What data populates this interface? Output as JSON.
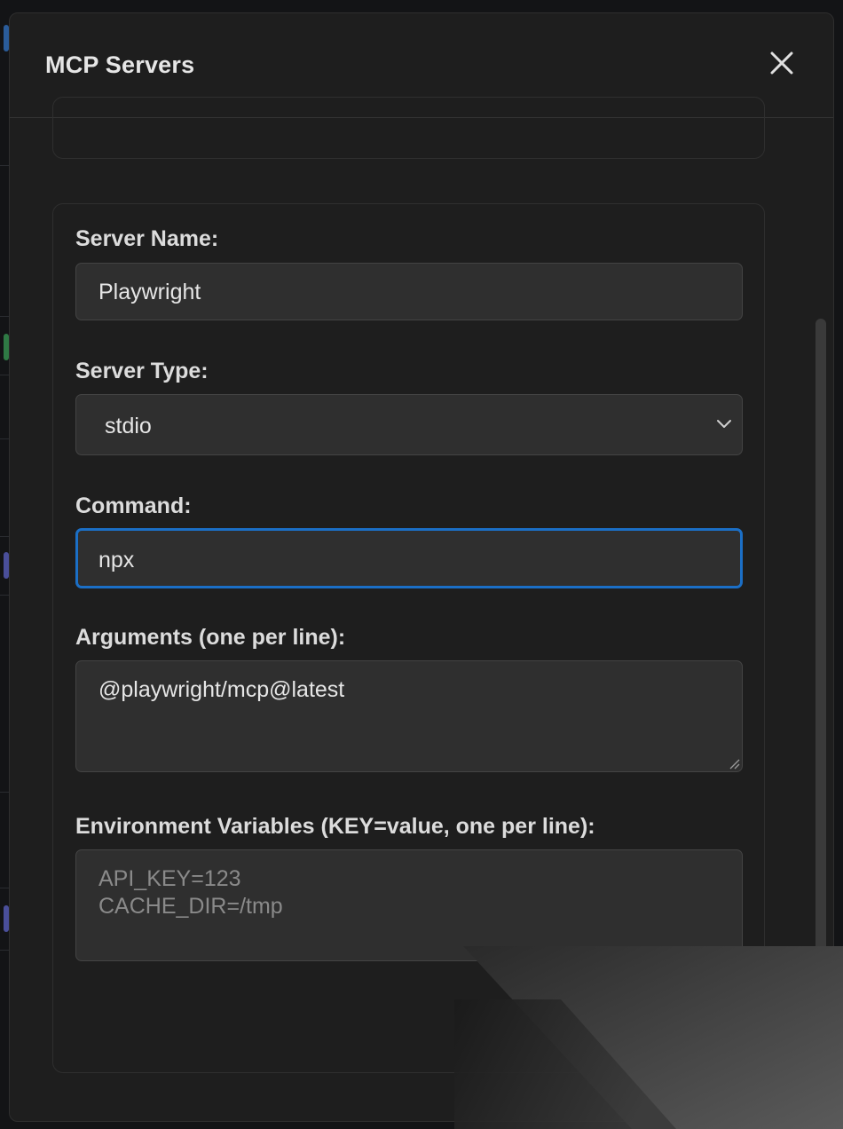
{
  "modal": {
    "title": "MCP Servers"
  },
  "form": {
    "server_name": {
      "label": "Server Name:",
      "value": "Playwright"
    },
    "server_type": {
      "label": "Server Type:",
      "selected": "stdio"
    },
    "command": {
      "label": "Command:",
      "value": "npx"
    },
    "arguments": {
      "label": "Arguments (one per line):",
      "value": "@playwright/mcp@latest"
    },
    "env": {
      "label": "Environment Variables (KEY=value, one per line):",
      "placeholder": "API_KEY=123\nCACHE_DIR=/tmp"
    }
  },
  "icons": {
    "close": "close-icon",
    "dropdown": "chevron-down-icon",
    "resize": "resize-grip-icon"
  },
  "colors": {
    "focus_border": "#1b6fc6",
    "modal_bg": "#1e1e1e",
    "input_bg": "#2f2f2f"
  }
}
